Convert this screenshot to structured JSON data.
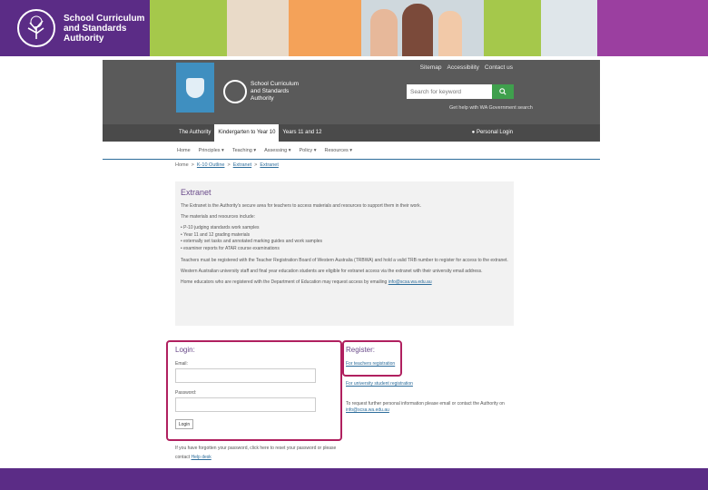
{
  "brand": {
    "name_line1": "School Curriculum",
    "name_line2": "and Standards",
    "name_line3": "Authority",
    "color": "#5b2c86"
  },
  "site": {
    "logo_line1": "School Curriculum",
    "logo_line2": "and Standards",
    "logo_line3": "Authority",
    "utility_links": [
      "Sitemap",
      "Accessibility",
      "Contact us"
    ],
    "search_placeholder": "Search for keyword",
    "help_text": "Get help with WA Government search",
    "nav_tabs": [
      "The Authority",
      "Kindergarten to Year 10",
      "Years 11 and 12"
    ],
    "nav_active_index": 1,
    "login_label": "Personal Login",
    "subnav": [
      "Home",
      "Principles",
      "Teaching",
      "Assessing",
      "Policy",
      "Resources"
    ]
  },
  "breadcrumb": {
    "items": [
      "Home",
      "K-10 Outline",
      "Extranet",
      "Extranet"
    ]
  },
  "extranet": {
    "title": "Extranet",
    "intro": "The Extranet is the Authority's secure area for teachers to access materials and resources to support them in their work.",
    "list_intro": "The materials and resources include:",
    "items": [
      "P-10 judging standards work samples",
      "Year 11 and 12 grading materials",
      "externally set tasks and annotated marking guides and work samples",
      "examiner reports for ATAR course examinations"
    ],
    "para1": "Teachers must be registered with the Teacher Registration Board of Western Australia (TRBWA) and hold a valid TRB number to register for access to the extranet.",
    "para2": "Western Australian university staff and final year education students are eligible for extranet access via the extranet with their university email address.",
    "para3": "Home educators who are registered with the Department of Education may request access by emailing",
    "email": "info@scsa.wa.edu.au"
  },
  "login": {
    "title": "Login:",
    "email_label": "Email:",
    "password_label": "Password:",
    "button": "Login"
  },
  "register": {
    "title": "Register:",
    "link1": "For teachers registration",
    "link2": "For university student registration",
    "text": "To request further personal information please email or contact the Authority on",
    "email": "info@scsa.wa.edu.au"
  },
  "footer_note": {
    "text": "If you have forgotten your password, click here to reset your password or please contact",
    "link": "Help desk"
  },
  "colors": {
    "highlight": "#b0205f",
    "heading": "#6a4b8a",
    "link": "#2d6d9b"
  }
}
